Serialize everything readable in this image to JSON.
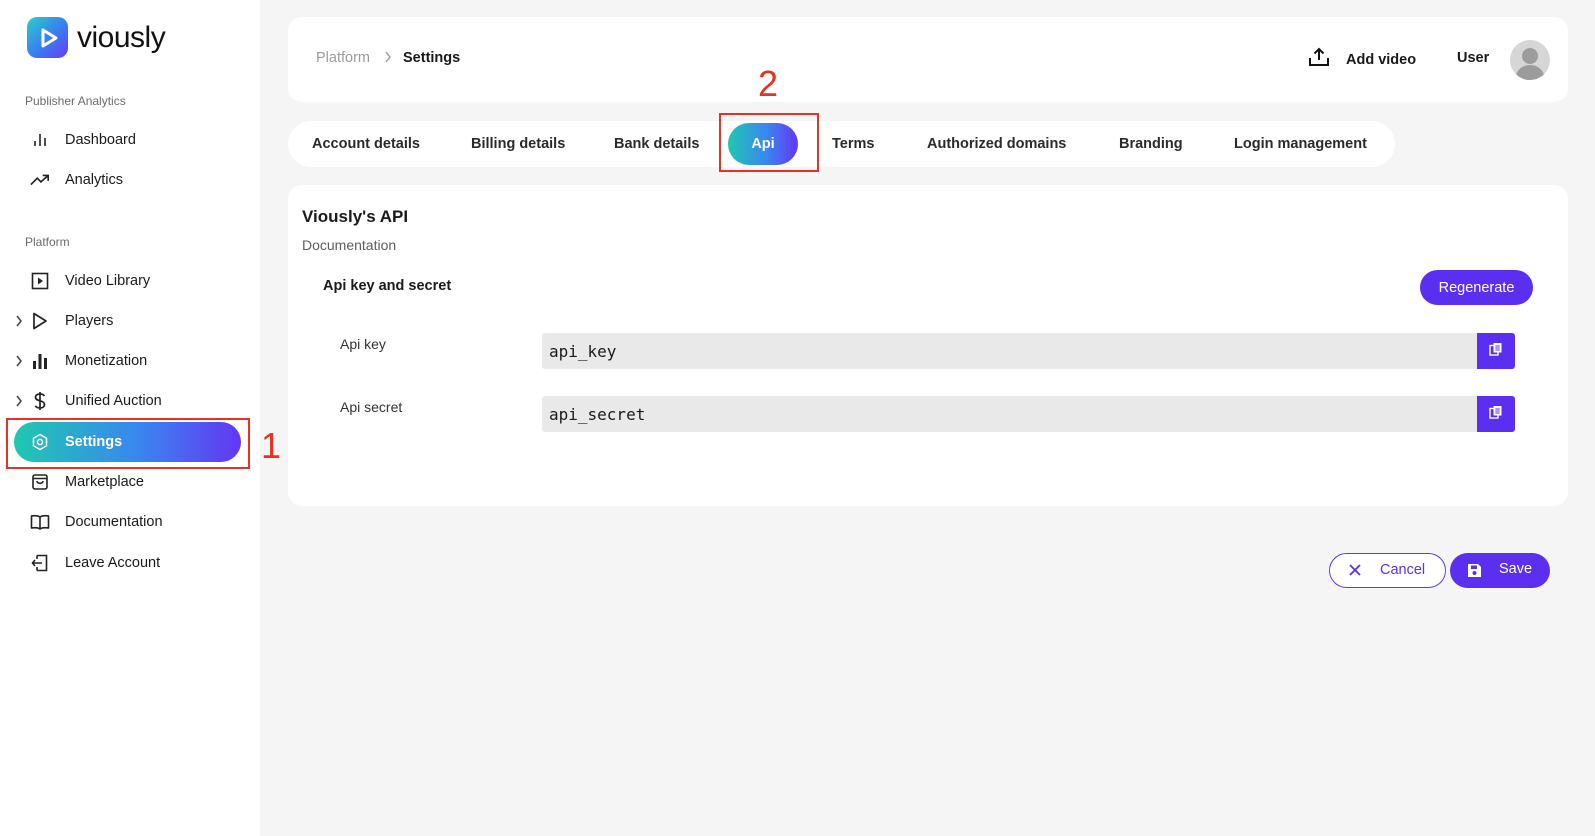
{
  "app": {
    "brand": "viously"
  },
  "sidebar": {
    "sections": [
      {
        "label": "Publisher Analytics"
      },
      {
        "label": "Platform"
      }
    ],
    "items": [
      {
        "label": "Dashboard",
        "icon": "bar-chart-icon"
      },
      {
        "label": "Analytics",
        "icon": "trend-up-icon"
      },
      {
        "label": "Video Library",
        "icon": "video-library-icon"
      },
      {
        "label": "Players",
        "icon": "play-icon"
      },
      {
        "label": "Monetization",
        "icon": "bar-chart-filled-icon"
      },
      {
        "label": "Unified Auction",
        "icon": "dollar-icon"
      },
      {
        "label": "Settings",
        "icon": "gear-icon"
      },
      {
        "label": "Marketplace",
        "icon": "shopping-bag-icon"
      },
      {
        "label": "Documentation",
        "icon": "book-icon"
      },
      {
        "label": "Leave Account",
        "icon": "exit-icon"
      }
    ]
  },
  "header": {
    "breadcrumb": [
      "Platform",
      "Settings"
    ],
    "add_video": "Add video",
    "user": "User"
  },
  "tabs": [
    "Account details",
    "Billing details",
    "Bank details",
    "Api",
    "Terms",
    "Authorized domains",
    "Branding",
    "Login management"
  ],
  "active_tab": "Api",
  "card": {
    "title": "Viously's API",
    "subtitle": "Documentation",
    "section_title": "Api key and secret",
    "regenerate": "Regenerate",
    "fields": [
      {
        "label": "Api key",
        "value": "api_key"
      },
      {
        "label": "Api secret",
        "value": "api_secret"
      }
    ]
  },
  "actions": {
    "cancel": "Cancel",
    "save": "Save"
  },
  "annotations": [
    "1",
    "2"
  ],
  "colors": {
    "accent": "#5a2ff0",
    "annotation": "#e53224",
    "gradient_start": "#1fc8b0",
    "gradient_end": "#6436f2"
  }
}
